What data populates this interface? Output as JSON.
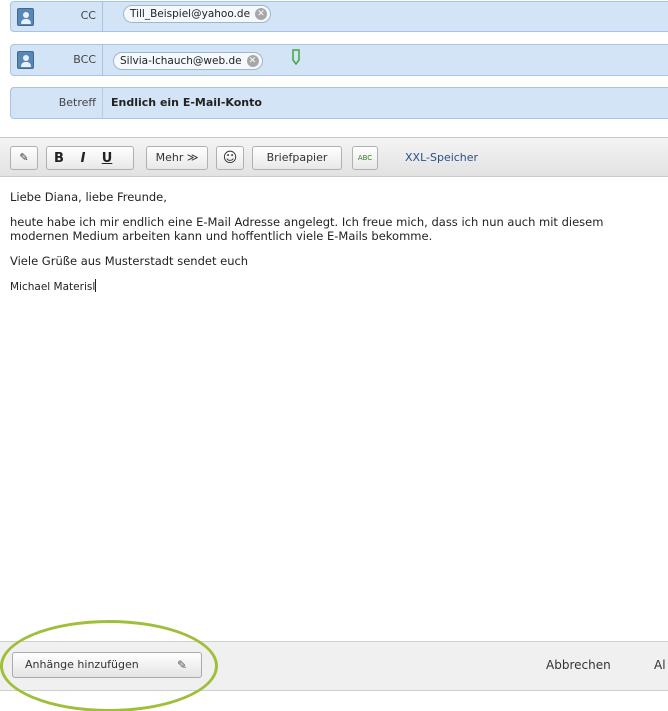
{
  "header": {
    "cc": {
      "label": "CC",
      "recipient": "Till_Beispiel@yahoo.de"
    },
    "bcc": {
      "label": "BCC",
      "recipient": "Silvia-Ichauch@web.de"
    },
    "subject": {
      "label": "Betreff",
      "value": "Endlich ein E-Mail-Konto"
    }
  },
  "toolbar": {
    "bold": "B",
    "italic": "I",
    "underline": "U",
    "more": "Mehr ≫",
    "letterhead": "Briefpapier",
    "spellcheck": "ABC",
    "xxl": "XXL-Speicher"
  },
  "body": {
    "greeting": "Liebe Diana, liebe Freunde,",
    "paragraph": "heute habe ich mir endlich eine E-Mail Adresse angelegt. Ich freue mich, dass ich nun auch mit diesem modernen Medium arbeiten kann und hoffentlich viele E-Mails bekomme.",
    "closing": "Viele Grüße aus Musterstadt sendet euch",
    "signature": "Michael Materisl"
  },
  "footer": {
    "attach": "Anhänge hinzufügen",
    "cancel": "Abbrechen",
    "more": "Al"
  },
  "colors": {
    "header_bg": "#d3e4f6",
    "highlight": "#9fbf3b",
    "link": "#2b4f86"
  },
  "icons": {
    "contact": "address-book-icon",
    "remove": "remove-chip-icon",
    "attach": "paperclip-icon",
    "smiley": "smiley-icon",
    "spellcheck": "spellcheck-icon"
  }
}
